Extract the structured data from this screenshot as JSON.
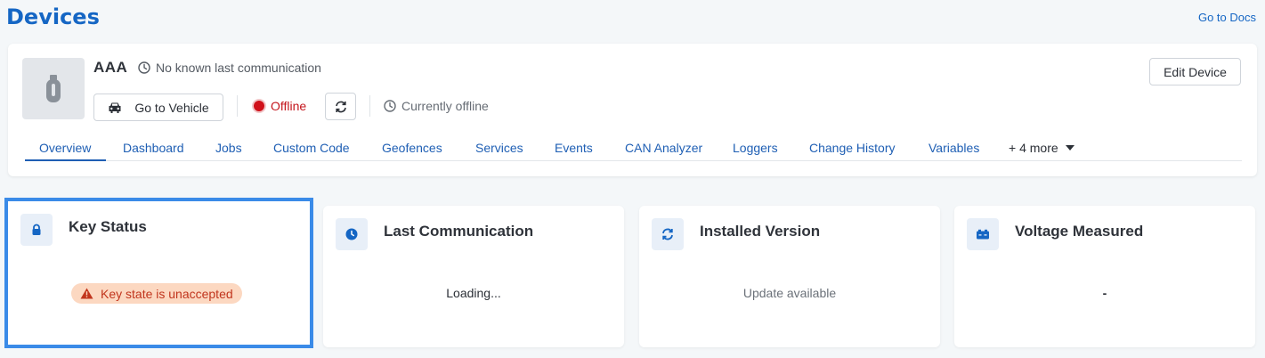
{
  "page": {
    "title": "Devices",
    "docs_link": "Go to Docs"
  },
  "device": {
    "name": "AAA",
    "last_communication": "No known last communication",
    "go_to_vehicle_label": "Go to Vehicle",
    "status": "Offline",
    "currently_text": "Currently offline",
    "edit_label": "Edit Device"
  },
  "tabs": [
    {
      "label": "Overview",
      "active": true
    },
    {
      "label": "Dashboard"
    },
    {
      "label": "Jobs"
    },
    {
      "label": "Custom Code"
    },
    {
      "label": "Geofences"
    },
    {
      "label": "Services"
    },
    {
      "label": "Events"
    },
    {
      "label": "CAN Analyzer"
    },
    {
      "label": "Loggers"
    },
    {
      "label": "Change History"
    },
    {
      "label": "Variables"
    }
  ],
  "more_tabs_label": "+ 4 more",
  "cards": {
    "key_status": {
      "title": "Key Status",
      "value": "Key state is unaccepted",
      "icon": "lock-icon"
    },
    "last_communication": {
      "title": "Last Communication",
      "value": "Loading...",
      "icon": "clock-icon"
    },
    "installed_version": {
      "title": "Installed Version",
      "value": "Update available",
      "icon": "sync-icon"
    },
    "voltage": {
      "title": "Voltage Measured",
      "value": "-",
      "icon": "battery-icon"
    }
  },
  "colors": {
    "accent": "#1566c4",
    "offline": "#d0111a",
    "warning_bg": "#fcd8c1",
    "warning_text": "#c1351d",
    "selection": "#3a8be8"
  }
}
